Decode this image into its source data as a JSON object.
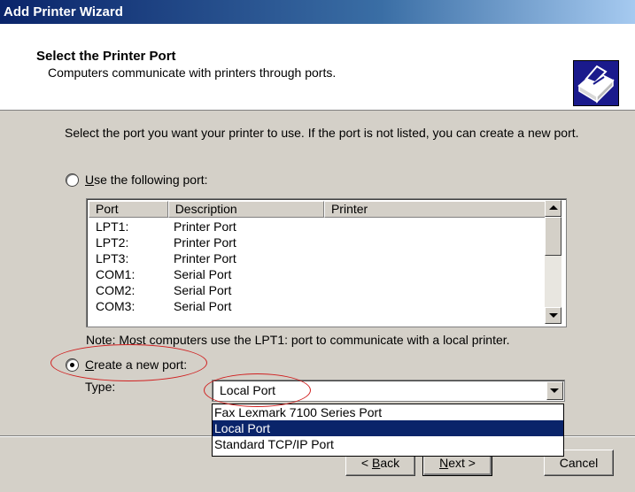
{
  "window": {
    "title": "Add Printer Wizard"
  },
  "header": {
    "title": "Select the Printer Port",
    "subtitle": "Computers communicate with printers through ports.",
    "icon": "printer-icon"
  },
  "intro_text": "Select the port you want your printer to use.  If the port is not listed, you can create a new port.",
  "use_port": {
    "label_pre": "",
    "label_u": "U",
    "label_post": "se the following port:",
    "selected": false
  },
  "port_list": {
    "columns": [
      "Port",
      "Description",
      "Printer"
    ],
    "rows": [
      {
        "port": "LPT1:",
        "description": "Printer Port",
        "printer": ""
      },
      {
        "port": "LPT2:",
        "description": "Printer Port",
        "printer": ""
      },
      {
        "port": "LPT3:",
        "description": "Printer Port",
        "printer": ""
      },
      {
        "port": "COM1:",
        "description": "Serial Port",
        "printer": ""
      },
      {
        "port": "COM2:",
        "description": "Serial Port",
        "printer": ""
      },
      {
        "port": "COM3:",
        "description": "Serial Port",
        "printer": ""
      }
    ]
  },
  "note": "Note: Most computers use the LPT1: port to communicate with a local printer.",
  "create_port": {
    "label_u": "C",
    "label_post": "reate a new port:",
    "selected": true
  },
  "type": {
    "label": "Type:",
    "value": "Local Port",
    "options": [
      {
        "label": "Fax Lexmark 7100 Series Port",
        "selected": false
      },
      {
        "label": "Local Port",
        "selected": true
      },
      {
        "label": "Standard TCP/IP Port",
        "selected": false
      }
    ]
  },
  "buttons": {
    "back_u": "B",
    "back_pre": "< ",
    "back_post": "ack",
    "next_u": "N",
    "next_post": "ext >",
    "cancel": "Cancel"
  },
  "colors": {
    "highlight": "#0a246a",
    "annotation": "#d02020"
  }
}
